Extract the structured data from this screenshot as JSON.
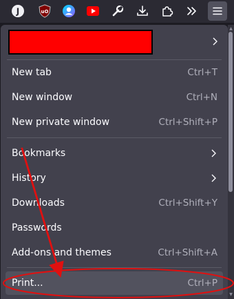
{
  "toolbar": {
    "icons": [
      {
        "name": "extension-j-icon",
        "glyph": "J"
      },
      {
        "name": "ublock-origin-icon",
        "glyph": "uO"
      },
      {
        "name": "profile-icon"
      },
      {
        "name": "youtube-icon"
      },
      {
        "name": "wrench-icon"
      },
      {
        "name": "downloads-icon"
      },
      {
        "name": "extensions-puzzle-icon"
      },
      {
        "name": "overflow-chevrons-icon"
      },
      {
        "name": "hamburger-menu-icon"
      }
    ]
  },
  "menu": {
    "sections": [
      [
        {
          "label": "New tab",
          "shortcut": "Ctrl+T"
        },
        {
          "label": "New window",
          "shortcut": "Ctrl+N"
        },
        {
          "label": "New private window",
          "shortcut": "Ctrl+Shift+P"
        }
      ],
      [
        {
          "label": "Bookmarks",
          "submenu": true
        },
        {
          "label": "History",
          "submenu": true
        },
        {
          "label": "Downloads",
          "shortcut": "Ctrl+Shift+Y"
        },
        {
          "label": "Passwords"
        },
        {
          "label": "Add-ons and themes",
          "shortcut": "Ctrl+Shift+A"
        }
      ],
      [
        {
          "label": "Print...",
          "shortcut": "Ctrl+P",
          "hovered": true
        }
      ]
    ]
  },
  "colors": {
    "redaction": "#ff0000",
    "annotation": "#e01010",
    "youtube": "#ff0000",
    "ublock": "#800000"
  }
}
